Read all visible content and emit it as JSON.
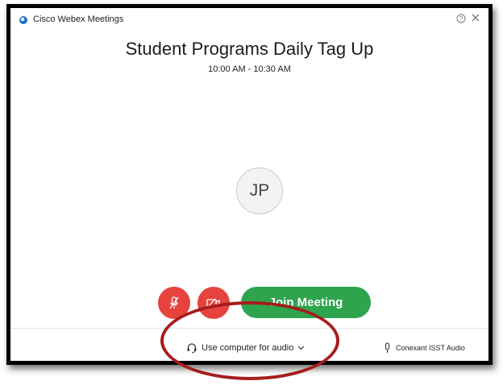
{
  "window": {
    "app_title": "Cisco Webex Meetings",
    "help_icon": "help-icon",
    "close_icon": "close-icon"
  },
  "meeting": {
    "title": "Student Programs Daily Tag Up",
    "time": "10:00 AM - 10:30 AM"
  },
  "avatar": {
    "initials": "JP"
  },
  "controls": {
    "mute_icon": "microphone-muted-icon",
    "video_icon": "video-off-icon",
    "join_label": "Join Meeting"
  },
  "audio": {
    "option_label": "Use computer for audio",
    "option_icon": "headset-icon",
    "device_label": "Conexant ISST Audio",
    "device_icon": "microphone-icon"
  },
  "colors": {
    "join_button": "#2ea44f",
    "mute_video_buttons": "#e6433d",
    "annotation_ellipse": "#a61c1c",
    "logo": "#1a73c9"
  }
}
